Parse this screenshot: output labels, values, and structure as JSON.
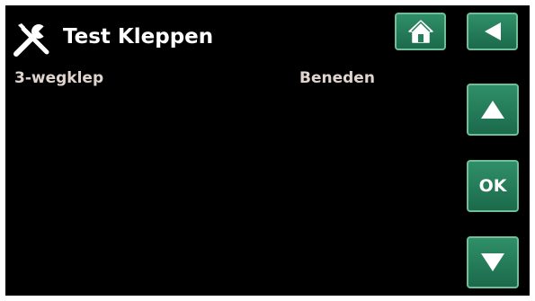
{
  "header": {
    "title": "Test Kleppen",
    "icon": "tools-icon"
  },
  "settings": [
    {
      "label": "3-wegklep",
      "value": "Beneden"
    }
  ],
  "nav": {
    "home_icon": "home-icon",
    "back_icon": "back-arrow-icon",
    "up_icon": "up-arrow-icon",
    "down_icon": "down-arrow-icon",
    "ok_label": "OK"
  },
  "colors": {
    "background": "#000000",
    "button": "#24805b",
    "button_border": "#6fbf98",
    "text": "#ffffff",
    "value_text": "#e0d4cf"
  }
}
